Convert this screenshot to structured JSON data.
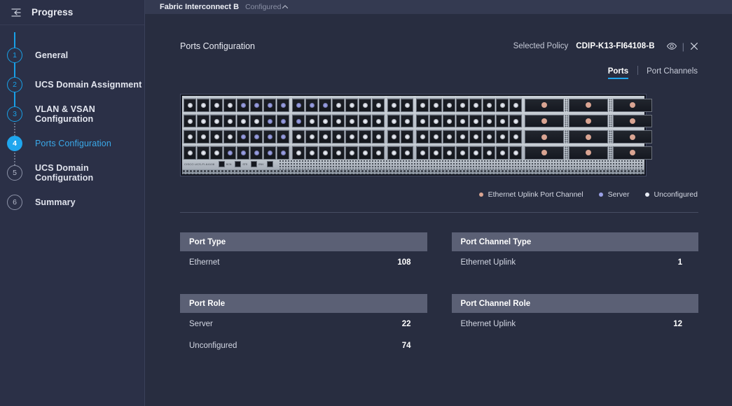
{
  "sidebar": {
    "collapse_icon": "collapse-sidebar-icon",
    "title": "Progress",
    "steps": [
      {
        "num": "1",
        "label": "General",
        "state": "done"
      },
      {
        "num": "2",
        "label": "UCS Domain Assignment",
        "state": "done"
      },
      {
        "num": "3",
        "label": "VLAN & VSAN Configuration",
        "state": "done"
      },
      {
        "num": "4",
        "label": "Ports Configuration",
        "state": "active"
      },
      {
        "num": "5",
        "label": "UCS Domain Configuration",
        "state": "todo"
      },
      {
        "num": "6",
        "label": "Summary",
        "state": "todo"
      }
    ]
  },
  "accordion": {
    "title": "Fabric Interconnect B",
    "status": "Configured",
    "chevron_icon": "chevron-up-icon"
  },
  "panel": {
    "title": "Ports Configuration",
    "policy_label": "Selected Policy",
    "policy_value": "CDIP-K13-FI64108-B",
    "eye_icon": "eye-icon",
    "separator": "|",
    "close_icon": "close-icon"
  },
  "tabs": [
    {
      "label": "Ports",
      "active": true
    },
    {
      "label": "Port Channels",
      "active": false
    }
  ],
  "device": {
    "model_text": "CISCO UCS-FI-64108"
  },
  "legend": [
    {
      "label": "Ethernet Uplink Port Channel",
      "color": "#d9a492"
    },
    {
      "label": "Server",
      "color": "#9aa0e6"
    },
    {
      "label": "Unconfigured",
      "color": "#e8ecf5"
    }
  ],
  "tables": {
    "left": [
      {
        "header": "Port Type",
        "rows": [
          {
            "key": "Ethernet",
            "value": "108"
          }
        ]
      },
      {
        "header": "Port Role",
        "rows": [
          {
            "key": "Server",
            "value": "22"
          },
          {
            "key": "Unconfigured",
            "value": "74"
          }
        ]
      }
    ],
    "right": [
      {
        "header": "Port Channel Type",
        "rows": [
          {
            "key": "Ethernet Uplink",
            "value": "1"
          }
        ]
      },
      {
        "header": "Port Channel Role",
        "rows": [
          {
            "key": "Ethernet Uplink",
            "value": "12"
          }
        ]
      }
    ]
  },
  "colors": {
    "accent": "#1fa6ee",
    "page_bg": "#282d40",
    "sidebar_bg": "#2b3047",
    "accordion_bg": "#343a51",
    "table_header_bg": "#5b6075"
  }
}
